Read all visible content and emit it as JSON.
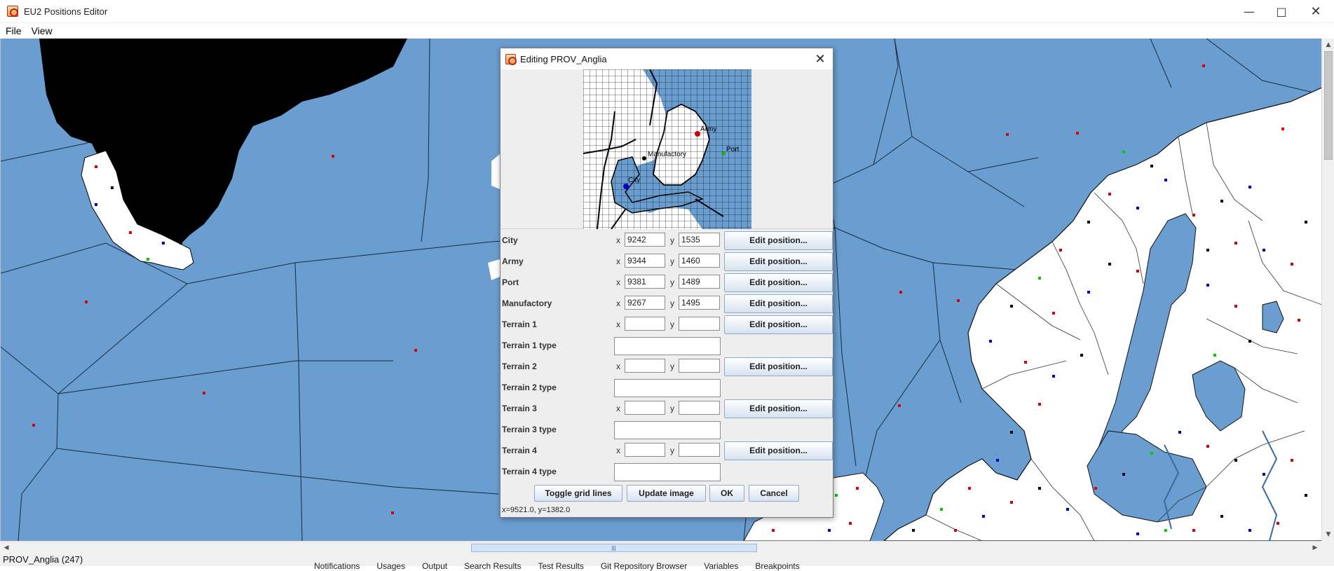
{
  "window": {
    "title": "EU2 Positions Editor",
    "minimize_icon": "minimize-icon",
    "maximize_icon": "maximize-icon",
    "close_icon": "close-icon"
  },
  "menu": [
    {
      "label": "File"
    },
    {
      "label": "View"
    }
  ],
  "dialog": {
    "title": "Editing PROV_Anglia",
    "preview": {
      "labels": {
        "army": "Army",
        "port": "Port",
        "manufactory": "Manufactory",
        "city": "City"
      }
    },
    "rows": [
      {
        "label": "City",
        "x": "9242",
        "y": "1535",
        "button": "Edit position..."
      },
      {
        "label": "Army",
        "x": "9344",
        "y": "1460",
        "button": "Edit position..."
      },
      {
        "label": "Port",
        "x": "9381",
        "y": "1489",
        "button": "Edit position..."
      },
      {
        "label": "Manufactory",
        "x": "9267",
        "y": "1495",
        "button": "Edit position..."
      },
      {
        "label": "Terrain 1",
        "x": "",
        "y": "",
        "button": "Edit position..."
      },
      {
        "label": "Terrain 1 type",
        "value": ""
      },
      {
        "label": "Terrain 2",
        "x": "",
        "y": "",
        "button": "Edit position..."
      },
      {
        "label": "Terrain 2 type",
        "value": ""
      },
      {
        "label": "Terrain 3",
        "x": "",
        "y": "",
        "button": "Edit position..."
      },
      {
        "label": "Terrain 3 type",
        "value": ""
      },
      {
        "label": "Terrain 4",
        "x": "",
        "y": "",
        "button": "Edit position..."
      },
      {
        "label": "Terrain 4 type",
        "value": ""
      }
    ],
    "x_label": "x",
    "y_label": "y",
    "buttons": {
      "toggle": "Toggle grid lines",
      "update": "Update image",
      "ok": "OK",
      "cancel": "Cancel"
    },
    "coord_readout": "x=9521.0, y=1382.0"
  },
  "status": {
    "text": "PROV_Anglia (247)",
    "background_tabs": [
      "Notifications",
      "Usages",
      "Output",
      "Search Results",
      "Test Results",
      "Git Repository Browser",
      "Variables",
      "Breakpoints"
    ]
  },
  "colors": {
    "sea": "#6a9dd0",
    "land": "#ffffff",
    "border": "#1a1a1a",
    "unknown_land": "#000000",
    "button_gradient_bottom": "#d7e2f0"
  }
}
